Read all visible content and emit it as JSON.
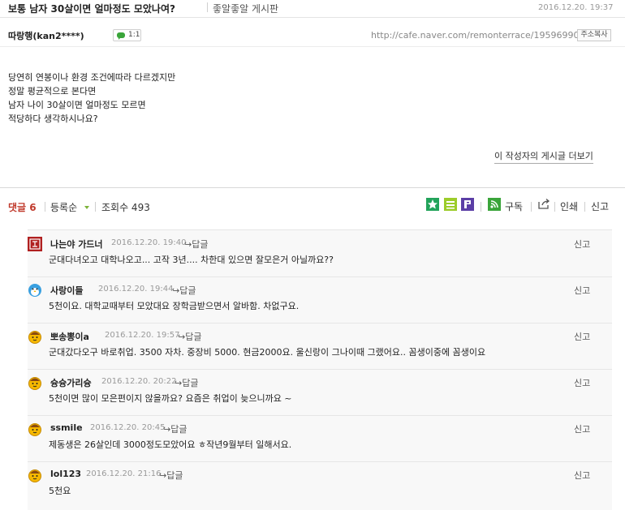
{
  "header": {
    "title": "보통 남자 30살이면 얼마정도 모았나여?",
    "board": "좋알좋알 게시판",
    "date": "2016.12.20. 19:37"
  },
  "author": {
    "nick": "따랑행(kan2****)",
    "comment_count": "1:1"
  },
  "post_url": "http://cafe.naver.com/remonterrace/19596990",
  "copy_button": "주소복사",
  "body_lines": [
    "당연히 연봉이나 환경 조건에따라 다르겠지만",
    "정말 평균적으로 본다면",
    "남자 나이 30살이면 얼마정도 모르면",
    "적당하다 생각하시나요?"
  ],
  "more_posts": "이 작성자의 게시글 더보기",
  "toolbar": {
    "comments_label": "댓글 6",
    "sort_label": "등록순",
    "views_label": "조회수 493",
    "subscribe": "구독",
    "print": "인쇄",
    "report": "신고"
  },
  "comments": [
    {
      "nick": "나는야 가드너",
      "date": "2016.12.20. 19:40",
      "reply": "답글",
      "text": "군대다녀오고 대학나오고... 고작 3년.... 차한대 있으면 잘모은거 아닐까요??",
      "report": "신고",
      "avatar": "stamp-avatar-icon"
    },
    {
      "nick": "사랑이들",
      "date": "2016.12.20. 19:44",
      "reply": "답글",
      "text": "5천이요. 대학교때부터 모았대요 장학금받으면서 알바함. 차없구요.",
      "report": "신고",
      "avatar": "penguin-avatar-icon"
    },
    {
      "nick": "뽀송뽕이a",
      "date": "2016.12.20. 19:57",
      "reply": "답글",
      "text": "군대갔다오구 바로취업. 3500 자차. 중장비 5000. 현금2000요. 울신랑이 그나이때 그랬어요.. 꼼생이중에 꼼생이요",
      "report": "신고",
      "avatar": "face-avatar-icon"
    },
    {
      "nick": "슝슝가리슝",
      "date": "2016.12.20. 20:22",
      "reply": "답글",
      "text": "5천이면 많이 모은편이지 않을까요? 요즘은 취업이 늦으니까요 ~",
      "report": "신고",
      "avatar": "face-avatar-icon"
    },
    {
      "nick": "ssmile",
      "date": "2016.12.20. 20:45",
      "reply": "답글",
      "text": "제동생은 26살인데 3000정도모았어요 ㅎ작년9월부터 일해서요.",
      "report": "신고",
      "avatar": "face-avatar-icon"
    },
    {
      "nick": "lol123",
      "date": "2016.12.20. 21:16",
      "reply": "답글",
      "text": "5천요",
      "report": "신고",
      "avatar": "face-avatar-icon"
    }
  ],
  "colors": {
    "comment_count_red": "#c0392b",
    "badge_green": "#3aa53a",
    "avatar_yellow": "#f6b800"
  }
}
